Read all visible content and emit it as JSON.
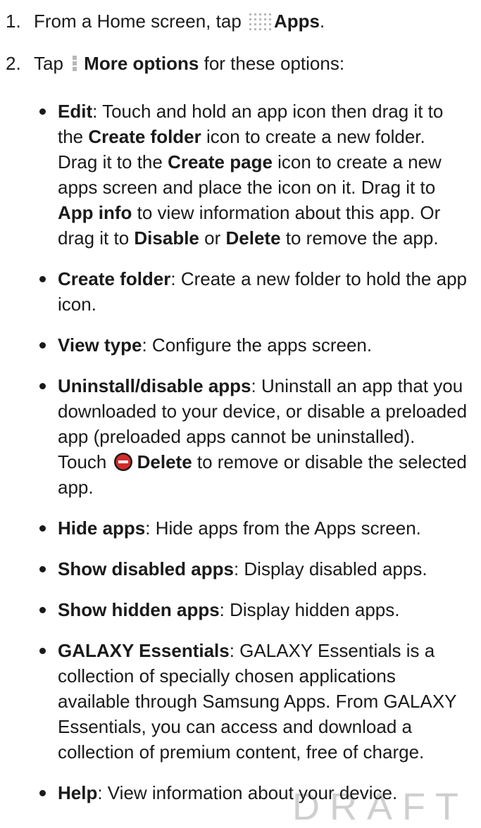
{
  "steps": [
    {
      "number": "1.",
      "pre": "From a Home screen, tap",
      "icon": "apps-grid-icon",
      "bold": "Apps",
      "post": "."
    },
    {
      "number": "2.",
      "pre": "Tap",
      "icon": "more-options-icon",
      "bold": "More options",
      "post": " for these options:"
    }
  ],
  "options": [
    {
      "title": "Edit",
      "text": [
        ": Touch and hold an app icon then drag it to the ",
        {
          "b": "Create folder"
        },
        " icon to create a new folder. Drag it to the ",
        {
          "b": "Create page"
        },
        " icon to create a new apps screen and place the icon on it. Drag it to ",
        {
          "b": "App info"
        },
        " to view information about this app. Or drag it to ",
        {
          "b": "Disable"
        },
        " or ",
        {
          "b": "Delete"
        },
        " to remove the app."
      ]
    },
    {
      "title": "Create folder",
      "text": [
        ": Create a new folder to hold the app icon."
      ]
    },
    {
      "title": "View type",
      "text": [
        ": Configure the apps screen."
      ]
    },
    {
      "title": "Uninstall/disable apps",
      "text": [
        ": Uninstall an app that you downloaded to your device, or disable a preloaded app (preloaded apps cannot be uninstalled). Touch ",
        {
          "icon": "delete-icon"
        },
        {
          "b": "Delete"
        },
        " to remove or disable the selected app."
      ]
    },
    {
      "title": "Hide apps",
      "text": [
        ": Hide apps from the Apps screen."
      ]
    },
    {
      "title": "Show disabled apps",
      "text": [
        ": Display disabled apps."
      ]
    },
    {
      "title": "Show hidden apps",
      "text": [
        ": Display hidden apps."
      ]
    },
    {
      "title": "GALAXY Essentials",
      "text": [
        ": GALAXY Essentials is a collection of specially chosen applications available through Samsung Apps. From GALAXY Essentials, you can access and download a collection of premium content, free of charge."
      ]
    },
    {
      "title": "Help",
      "text": [
        ": View information about your device."
      ]
    }
  ],
  "watermark": "DRAFT",
  "colors": {
    "text": "#1a1a1a",
    "icon_grey": "#b8b8b8",
    "watermark": "#cfcfcf"
  }
}
